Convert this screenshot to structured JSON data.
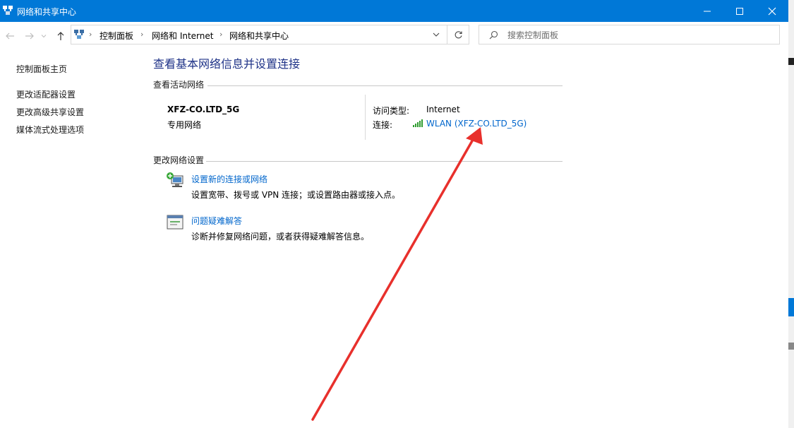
{
  "window": {
    "title": "网络和共享中心",
    "controls": {
      "minimize_icon": "minimize-icon",
      "maximize_icon": "maximize-icon",
      "close_icon": "close-icon"
    }
  },
  "nav": {
    "breadcrumbs": [
      "控制面板",
      "网络和 Internet",
      "网络和共享中心"
    ],
    "search_placeholder": "搜索控制面板"
  },
  "sidebar": {
    "items": [
      {
        "label": "控制面板主页"
      },
      {
        "label": "更改适配器设置"
      },
      {
        "label": "更改高级共享设置"
      },
      {
        "label": "媒体流式处理选项"
      }
    ]
  },
  "main": {
    "title": "查看基本网络信息并设置连接",
    "active_section": "查看活动网络",
    "network": {
      "name": "XFZ-CO.LTD_5G",
      "type": "专用网络",
      "access_label": "访问类型:",
      "access_value": "Internet",
      "connection_label": "连接:",
      "connection_value": "WLAN (XFZ-CO.LTD_5G)"
    },
    "change_section": "更改网络设置",
    "tasks": [
      {
        "title": "设置新的连接或网络",
        "desc": "设置宽带、拨号或 VPN 连接；或设置路由器或接入点。"
      },
      {
        "title": "问题疑难解答",
        "desc": "诊断并修复网络问题，或者获得疑难解答信息。"
      }
    ]
  },
  "colors": {
    "titlebar": "#0078d7",
    "link": "#0066cc",
    "heading": "#1e3287",
    "annotation_arrow": "#e8302c"
  }
}
